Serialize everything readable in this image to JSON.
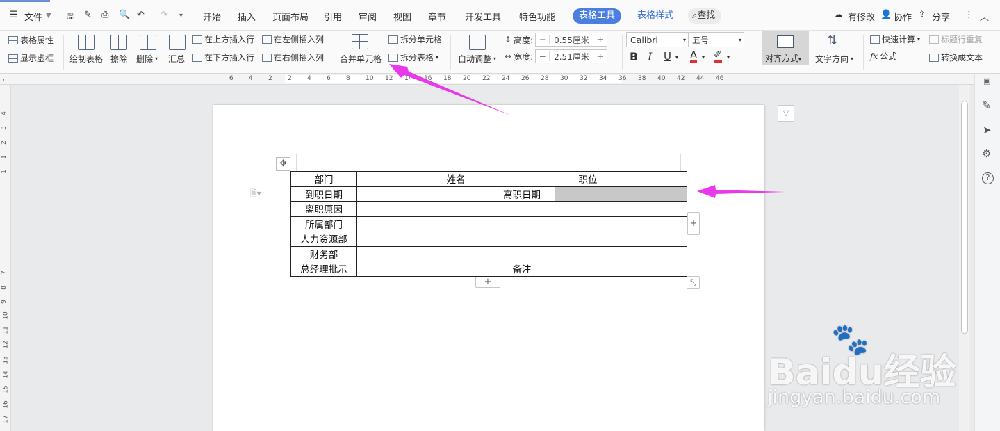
{
  "menu": {
    "file": "文件",
    "tabs": [
      "开始",
      "插入",
      "页面布局",
      "引用",
      "审阅",
      "视图",
      "章节",
      "开发工具",
      "特色功能"
    ],
    "table_tools": "表格工具",
    "table_style": "表格样式",
    "search": "查找",
    "modified": "有修改",
    "collab": "协作",
    "share": "分享"
  },
  "ribbon": {
    "table_props": "表格属性",
    "show_gridlines": "显示虚框",
    "draw_table": "绘制表格",
    "erase": "擦除",
    "delete": "删除",
    "summary": "汇总",
    "insert_above": "在上方插入行",
    "insert_below": "在下方插入行",
    "insert_left": "在左侧插入列",
    "insert_right": "在右侧插入列",
    "merge_cells": "合并单元格",
    "split_cells": "拆分单元格",
    "split_table": "拆分表格",
    "auto_fit": "自动调整",
    "height_label": "高度:",
    "height_value": "0.55厘米",
    "width_label": "宽度:",
    "width_value": "2.51厘米",
    "font_name": "Calibri",
    "font_size": "五号",
    "align": "对齐方式",
    "text_dir": "文字方向",
    "quick_calc": "快速计算",
    "header_repeat": "标题行重复",
    "formula": "公式",
    "to_text": "转换成文本"
  },
  "ruler_h": [
    "6",
    "4",
    "2",
    "2",
    "4",
    "6",
    "8",
    "10",
    "12",
    "14",
    "16",
    "18",
    "20",
    "22",
    "24",
    "26",
    "28",
    "30",
    "32",
    "34",
    "36",
    "38",
    "40",
    "42",
    "44",
    "46"
  ],
  "ruler_v": [
    "4",
    "3",
    "2",
    "1",
    "1",
    "7",
    "8",
    "9",
    "10",
    "11",
    "12",
    "13",
    "14",
    "15",
    "16",
    "17"
  ],
  "table": {
    "rows": [
      [
        "部门",
        "",
        "姓名",
        "",
        "职位",
        ""
      ],
      [
        "到职日期",
        "",
        "",
        "离职日期",
        "",
        ""
      ],
      [
        "离职原因",
        "",
        "",
        "",
        "",
        ""
      ],
      [
        "所属部门",
        "",
        "",
        "",
        "",
        ""
      ],
      [
        "人力资源部",
        "",
        "",
        "",
        "",
        ""
      ],
      [
        "财务部",
        "",
        "",
        "",
        "",
        ""
      ],
      [
        "总经理批示",
        "",
        "",
        "备注",
        "",
        ""
      ]
    ]
  },
  "watermark": {
    "brand": "Baidu经验",
    "url": "jingyan.baidu.com"
  },
  "colors": {
    "accent": "#4a7fe0",
    "annotation_arrow": "#e83ae8",
    "selected_cell": "#c8c8c8"
  }
}
